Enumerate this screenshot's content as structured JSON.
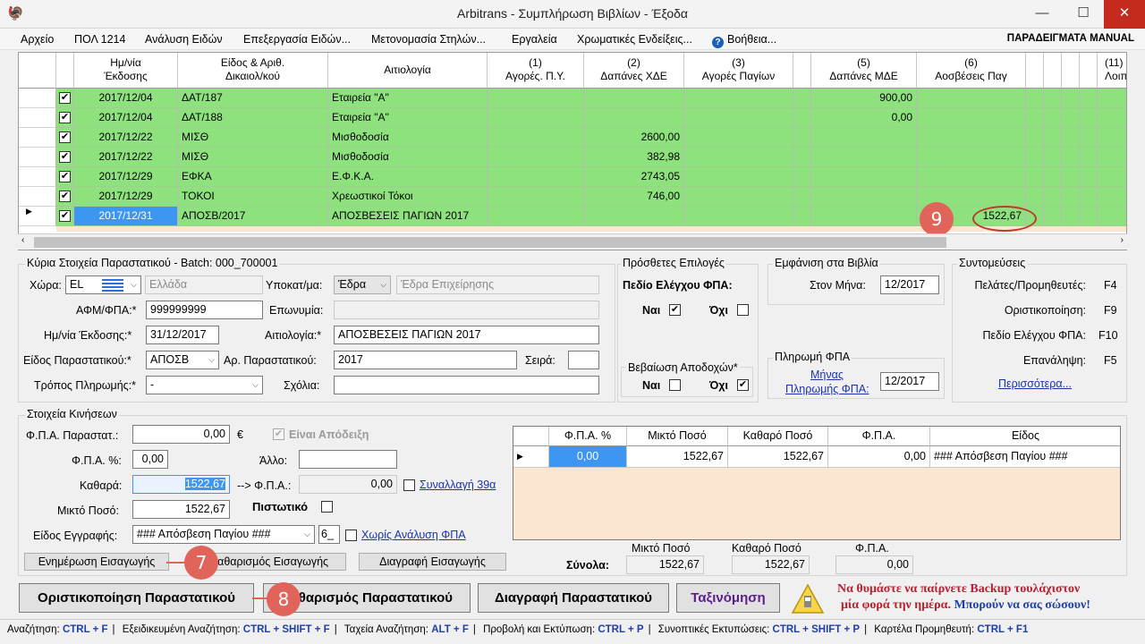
{
  "window": {
    "title": "Arbitrans - Συμπλήρωση Βιβλίων - Έξοδα"
  },
  "menu": {
    "items": [
      "Αρχείο",
      "ΠΟΛ 1214",
      "Ανάλυση Ειδών",
      "Επεξεργασία Ειδών...",
      "Μετονομασία Στηλών...",
      "Εργαλεία",
      "Χρωματικές Ενδείξεις...",
      "Βοήθεια..."
    ],
    "manual": "ΠΑΡΑΔΕΙΓΜΑΤΑ MANUAL"
  },
  "grid": {
    "headers": [
      "Ημ/νία\nΈκδοσης",
      "Είδος & Αριθ.\nΔικαιολ/κού",
      "Αιτιολογία",
      "(1)\nΑγορές. Π.Υ.",
      "(2)\nΔαπάνες ΧΔΕ",
      "(3)\nΑγορές Παγίων",
      "(5)\nΔαπάνες ΜΔΕ",
      "(6)\nΑοσβέσεις Παγ",
      "(11)\nΛοιπ"
    ],
    "rows": [
      {
        "date": "2017/12/04",
        "doc": "ΔΑΤ/187",
        "reason": "Εταιρεία \"Α\"",
        "c1": "",
        "c2": "",
        "c3": "",
        "c5": "900,00",
        "c6": ""
      },
      {
        "date": "2017/12/04",
        "doc": "ΔΑΤ/188",
        "reason": "Εταιρεία \"Α\"",
        "c1": "",
        "c2": "",
        "c3": "",
        "c5": "0,00",
        "c6": ""
      },
      {
        "date": "2017/12/22",
        "doc": "ΜΙΣΘ",
        "reason": "Μισθοδοσία",
        "c1": "",
        "c2": "2600,00",
        "c3": "",
        "c5": "",
        "c6": ""
      },
      {
        "date": "2017/12/22",
        "doc": "ΜΙΣΘ",
        "reason": "Μισθοδοσία",
        "c1": "",
        "c2": "382,98",
        "c3": "",
        "c5": "",
        "c6": ""
      },
      {
        "date": "2017/12/29",
        "doc": "ΕΦΚΑ",
        "reason": "Ε.Φ.Κ.Α.",
        "c1": "",
        "c2": "2743,05",
        "c3": "",
        "c5": "",
        "c6": ""
      },
      {
        "date": "2017/12/29",
        "doc": "ΤΟΚΟΙ",
        "reason": "Χρεωστικοί Τόκοι",
        "c1": "",
        "c2": "746,00",
        "c3": "",
        "c5": "",
        "c6": ""
      },
      {
        "date": "2017/12/31",
        "doc": "ΑΠΟΣΒ/2017",
        "reason": "ΑΠΟΣΒΕΣΕΙΣ ΠΑΓΙΩΝ 2017",
        "c1": "",
        "c2": "",
        "c3": "",
        "c5": "",
        "c6": "1522,67"
      }
    ]
  },
  "main": {
    "group_label": "Κύρια Στοιχεία Παραστατικού - Batch: 000_700001",
    "country_label": "Χώρα:",
    "country_code": "EL",
    "country_name": "Ελλάδα",
    "branch_label": "Υποκατ/μα:",
    "branch_value": "Έδρα",
    "branch_name": "Έδρα Επιχείρησης",
    "afm_label": "ΑΦΜ/ΦΠΑ:*",
    "afm_value": "999999999",
    "name_label": "Επωνυμία:",
    "date_label": "Ημ/νία Έκδοσης:*",
    "date_value": "31/12/2017",
    "reason_label": "Αιτιολογία:*",
    "reason_value": "ΑΠΟΣΒΕΣΕΙΣ ΠΑΓΙΩΝ 2017",
    "doctype_label": "Είδος Παραστατικού:*",
    "doctype_value": "ΑΠΟΣΒ",
    "docno_label": "Αρ. Παραστατικού:",
    "docno_value": "2017",
    "series_label": "Σειρά:",
    "payment_label": "Τρόπος Πληρωμής:*",
    "payment_value": "-",
    "comments_label": "Σχόλια:"
  },
  "extra": {
    "group_label": "Πρόσθετες Επιλογές",
    "vat_check_label": "Πεδίο Ελέγχου ΦΠΑ:",
    "yes": "Ναι",
    "no": "Όχι",
    "receipt_group": "Βεβαίωση Αποδοχών*"
  },
  "books": {
    "group_label": "Εμφάνιση στα Βιβλία",
    "month_label": "Στον Μήνα:",
    "month_value": "12/2017",
    "vatpay_group": "Πληρωμή ΦΠΑ",
    "vatpay_link1": "Μήνας",
    "vatpay_link2": "Πληρωμής ΦΠΑ:",
    "vatpay_value": "12/2017"
  },
  "shortcuts": {
    "group_label": "Συντομεύσεις",
    "items": [
      {
        "label": "Πελάτες/Προμηθευτές:",
        "key": "F4"
      },
      {
        "label": "Οριστικοποίηση:",
        "key": "F9"
      },
      {
        "label": "Πεδίο Ελέγχου ΦΠΑ:",
        "key": "F10"
      },
      {
        "label": "Επανάληψη:",
        "key": "F5"
      }
    ],
    "more_link": "Περισσότερα..."
  },
  "movements": {
    "group_label": "Στοιχεία Κινήσεων",
    "vat_doc_label": "Φ.Π.Α. Παραστατ.:",
    "vat_doc_value": "0,00",
    "currency": "€",
    "is_receipt_label": "Είναι Απόδειξη",
    "vat_pct_label": "Φ.Π.Α. %:",
    "vat_pct_value": "0,00",
    "other_label": "Άλλο:",
    "net_label": "Καθαρά:",
    "net_value": "1522,67",
    "arrow_vat_label": "--> Φ.Π.Α.:",
    "arrow_vat_value": "0,00",
    "txn39_link": "Συναλλαγή 39α",
    "gross_label": "Μικτό Ποσό:",
    "gross_value": "1522,67",
    "credit_label": "Πιστωτικό",
    "entry_type_label": "Είδος Εγγραφής:",
    "entry_type_value": "### Απόσβεση Παγίου ###",
    "entry_type_code": "6_",
    "no_vat_link": "Χωρίς Ανάλυση ΦΠΑ",
    "update_btn": "Ενημέρωση Εισαγωγής",
    "clear_btn": "Καθαρισμός Εισαγωγής",
    "delete_btn": "Διαγραφή Εισαγωγής"
  },
  "vat_table": {
    "headers": [
      "Φ.Π.Α. %",
      "Μικτό Ποσό",
      "Καθαρό Ποσό",
      "Φ.Π.Α.",
      "Είδος"
    ],
    "row": [
      "0,00",
      "1522,67",
      "1522,67",
      "0,00",
      "### Απόσβεση Παγίου ###"
    ]
  },
  "totals": {
    "label": "Σύνολα:",
    "gross_label": "Μικτό Ποσό",
    "gross_value": "1522,67",
    "net_label": "Καθαρό Ποσό",
    "net_value": "1522,67",
    "vat_label": "Φ.Π.Α.",
    "vat_value": "0,00"
  },
  "actions": {
    "finalize": "Οριστικοποίηση Παραστατικού",
    "clear": "Καθαρισμός Παραστατικού",
    "delete": "Διαγραφή Παραστατικού",
    "sort": "Ταξινόμηση"
  },
  "backup": {
    "line1": "Να θυμάστε να παίρνετε Backup τουλάχιστον",
    "line2a": "μία φορά την ημέρα. ",
    "line2b": "Μπορούν να σας σώσουν!"
  },
  "callouts": {
    "c7": "7",
    "c8": "8",
    "c9": "9"
  },
  "statusbar": [
    {
      "label": "Αναζήτηση:",
      "key": "CTRL + F"
    },
    {
      "label": "Εξειδικευμένη Αναζήτηση:",
      "key": "CTRL + SHIFT + F"
    },
    {
      "label": "Ταχεία Αναζήτηση:",
      "key": "ALT + F"
    },
    {
      "label": "Προβολή και Εκτύπωση:",
      "key": "CTRL + P"
    },
    {
      "label": "Συνοπτικές Εκτυπώσεις:",
      "key": "CTRL + SHIFT + P"
    },
    {
      "label": "Καρτέλα Προμηθευτή:",
      "key": "CTRL + F1"
    }
  ],
  "colors": {
    "row_green": "#8ee27d",
    "selected_blue": "#3d97f0",
    "callout_red": "#e0645a",
    "link_blue": "#1a33b3"
  },
  "icons": [
    "app-icon",
    "minimize-icon",
    "maximize-icon",
    "close-icon",
    "help-icon",
    "greek-flag-icon",
    "warning-icon",
    "row-pointer-icon"
  ]
}
